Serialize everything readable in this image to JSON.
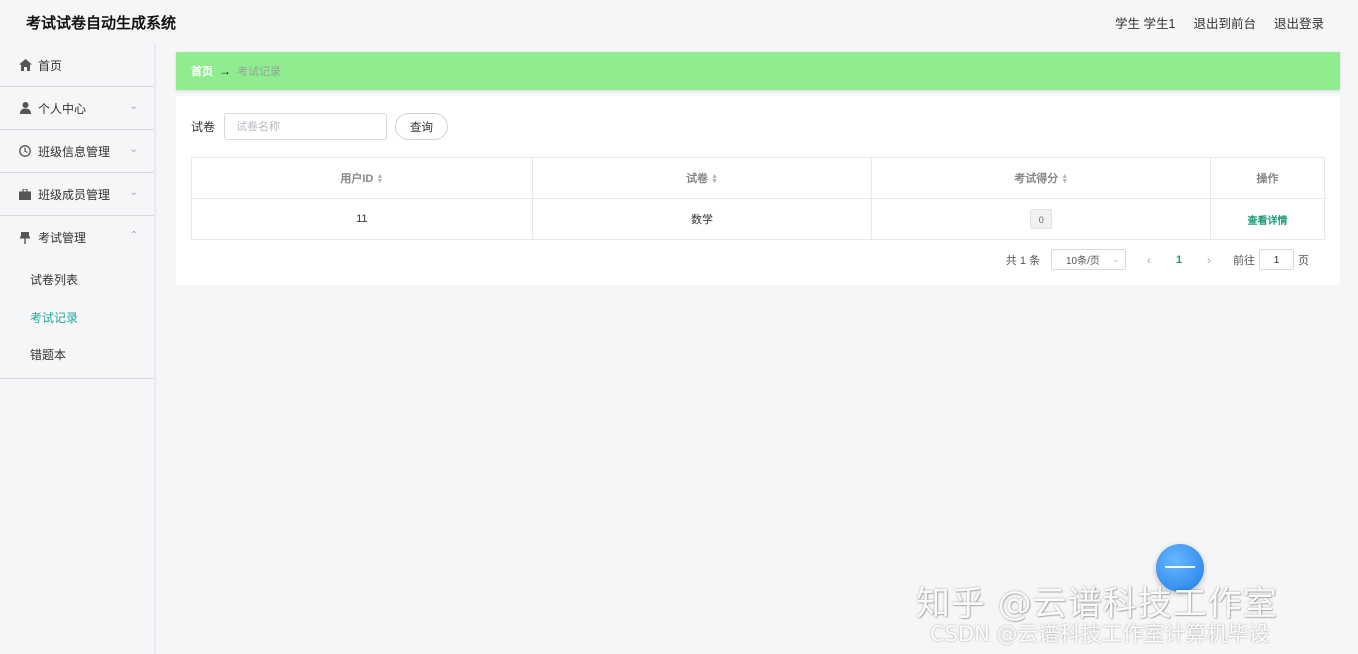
{
  "app": {
    "title": "考试试卷自动生成系统",
    "user_label": "学生 学生1",
    "back_to_front": "退出到前台",
    "logout": "退出登录"
  },
  "sidebar": {
    "items": [
      {
        "label": "首页",
        "icon": "home-icon"
      },
      {
        "label": "个人中心",
        "icon": "user-icon"
      },
      {
        "label": "班级信息管理",
        "icon": "clock-icon"
      },
      {
        "label": "班级成员管理",
        "icon": "briefcase-icon"
      },
      {
        "label": "考试管理",
        "icon": "pin-icon"
      }
    ],
    "sub_items": [
      {
        "label": "试卷列表"
      },
      {
        "label": "考试记录",
        "active": true
      },
      {
        "label": "错题本"
      }
    ]
  },
  "breadcrumb": {
    "home": "首页",
    "arrow": "→",
    "current": "考试记录"
  },
  "search": {
    "label": "试卷",
    "placeholder": "试卷名称",
    "value": "",
    "button": "查询"
  },
  "table": {
    "columns": [
      "用户ID",
      "试卷",
      "考试得分",
      "操作"
    ],
    "rows": [
      {
        "user_id": "11",
        "paper": "数学",
        "score": "0",
        "action": "查看详情"
      }
    ]
  },
  "pagination": {
    "total": "共 1 条",
    "page_size": "10条/页",
    "current_page": "1",
    "goto_label": "前往",
    "goto_value": "1",
    "page_suffix": "页"
  },
  "watermark": {
    "line1": "知乎 @云谱科技工作室",
    "line2": "CSDN @云谱科技工作室计算机毕设"
  },
  "colors": {
    "breadcrumb_bg": "#8fec8f",
    "accent": "#24a89a",
    "link": "#1f9b78",
    "page_bg": "#f5f6f8"
  }
}
